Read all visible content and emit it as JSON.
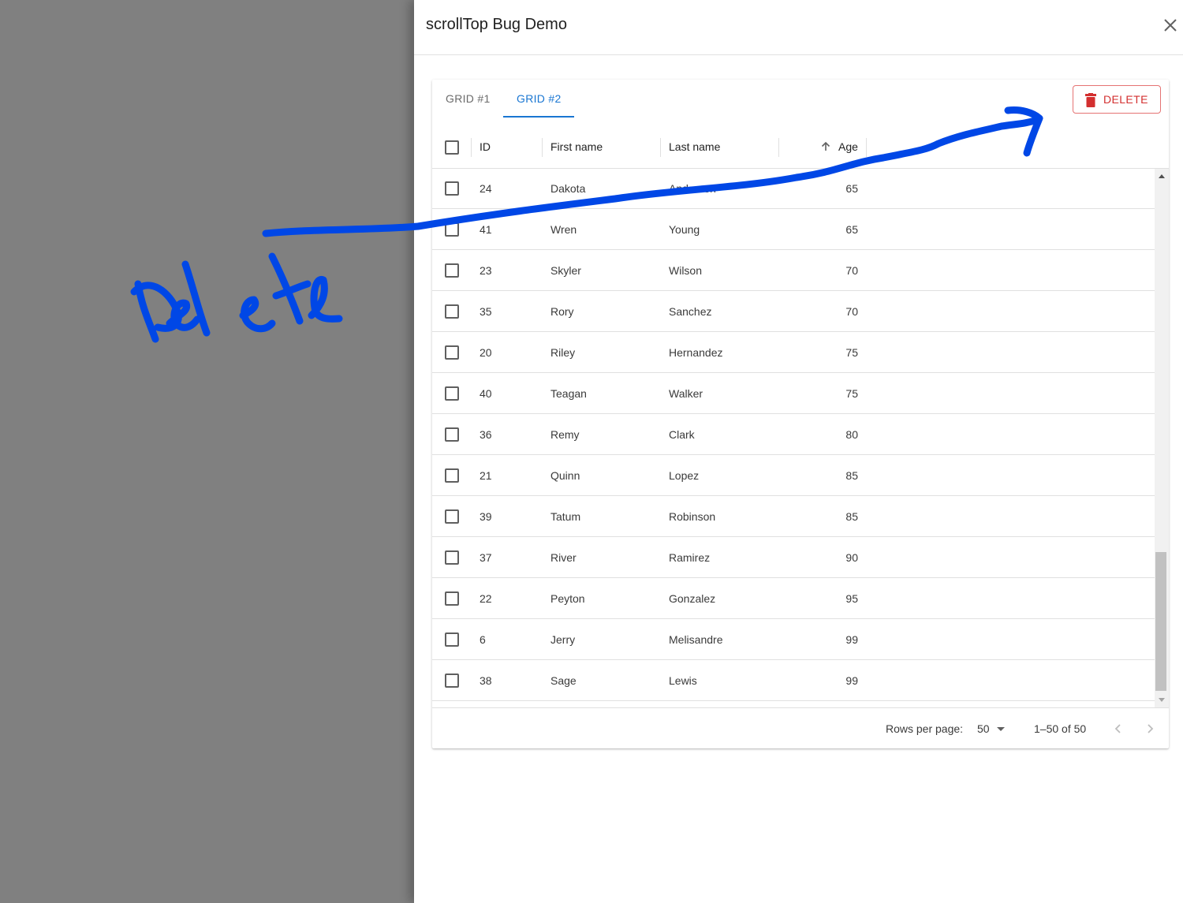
{
  "drawer": {
    "title": "scrollTop Bug Demo",
    "close_icon": "close-icon"
  },
  "tabs": [
    {
      "label": "GRID #1",
      "active": false
    },
    {
      "label": "GRID #2",
      "active": true
    }
  ],
  "toolbar": {
    "delete_label": "DELETE",
    "delete_icon": "trash-icon",
    "delete_color": "#d32f2f"
  },
  "grid": {
    "columns": {
      "id": "ID",
      "first_name": "First name",
      "last_name": "Last name",
      "age": "Age",
      "age_sort_icon": "arrow-up-icon"
    },
    "rows": [
      {
        "id": "24",
        "first": "Dakota",
        "last": "Anderson",
        "age": "65"
      },
      {
        "id": "41",
        "first": "Wren",
        "last": "Young",
        "age": "65"
      },
      {
        "id": "23",
        "first": "Skyler",
        "last": "Wilson",
        "age": "70"
      },
      {
        "id": "35",
        "first": "Rory",
        "last": "Sanchez",
        "age": "70"
      },
      {
        "id": "20",
        "first": "Riley",
        "last": "Hernandez",
        "age": "75"
      },
      {
        "id": "40",
        "first": "Teagan",
        "last": "Walker",
        "age": "75"
      },
      {
        "id": "36",
        "first": "Remy",
        "last": "Clark",
        "age": "80"
      },
      {
        "id": "21",
        "first": "Quinn",
        "last": "Lopez",
        "age": "85"
      },
      {
        "id": "39",
        "first": "Tatum",
        "last": "Robinson",
        "age": "85"
      },
      {
        "id": "37",
        "first": "River",
        "last": "Ramirez",
        "age": "90"
      },
      {
        "id": "22",
        "first": "Peyton",
        "last": "Gonzalez",
        "age": "95"
      },
      {
        "id": "6",
        "first": "Jerry",
        "last": "Melisandre",
        "age": "99"
      },
      {
        "id": "38",
        "first": "Sage",
        "last": "Lewis",
        "age": "99"
      }
    ]
  },
  "footer": {
    "rows_per_page_label": "Rows per page:",
    "rows_per_page_value": "50",
    "range": "1–50 of 50"
  },
  "colors": {
    "accent": "#1976d2",
    "annotation": "#0047e6",
    "backdrop": "#808080"
  },
  "annotation": {
    "handwritten_text": "Delete"
  }
}
